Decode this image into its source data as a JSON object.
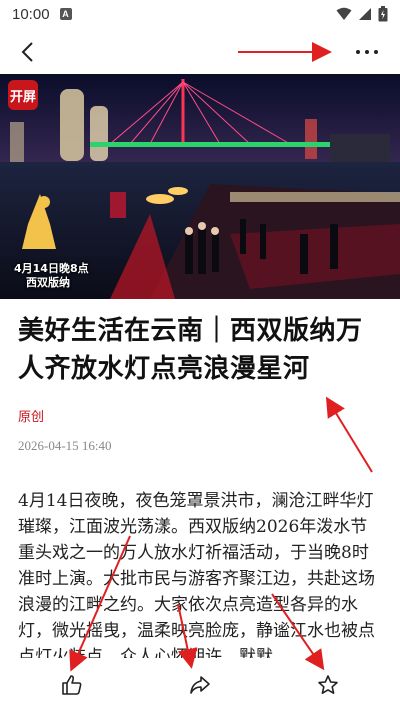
{
  "status_bar": {
    "time": "10:00",
    "notification_badge": "A"
  },
  "nav": {
    "back_icon": "chevron-left-icon",
    "more_icon": "more-horizontal-icon"
  },
  "hero": {
    "logo_text": "开屏",
    "caption_line1": "4月14日晚8点",
    "caption_line2": "西双版纳"
  },
  "article": {
    "title": "美好生活在云南｜西双版纳万人齐放水灯点亮浪漫星河",
    "tag": "原创",
    "date": "2026-04-15  16:40",
    "body": "4月14日夜晚，夜色笼罩景洪市，澜沧江畔华灯璀璨，江面波光荡漾。西双版纳2026年泼水节重头戏之一的万人放水灯祈福活动，于当晚8时准时上演。大批市民与游客齐聚江边，共赴这场浪漫的江畔之约。大家依次点亮造型各异的水灯，微光摇曳，温柔映亮脸庞，静谧江水也被点点灯火装点。众人心怀期许，默默"
  },
  "toolbar": {
    "like_icon": "thumbs-up-icon",
    "share_icon": "share-icon",
    "star_icon": "star-icon"
  },
  "colors": {
    "accent": "#c8161d",
    "arrow": "#e02020"
  }
}
